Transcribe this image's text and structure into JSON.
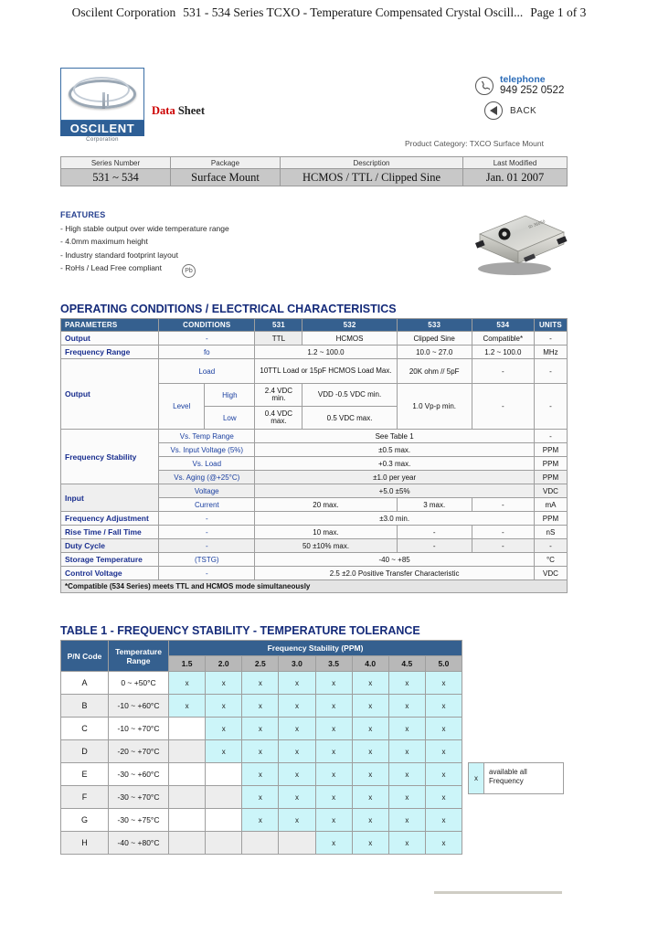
{
  "print_header": {
    "company": "Oscilent Corporation",
    "title": "531 - 534 Series TCXO - Temperature Compensated Crystal Oscill...",
    "page": "Page 1 of 3"
  },
  "logo": {
    "name": "OSCILENT",
    "sub": "Corporation",
    "data_sheet_red": "Data",
    "data_sheet_black": "Sheet"
  },
  "contact": {
    "telephone_label": "telephone",
    "telephone_number": "949 252 0522",
    "back_label": "BACK",
    "product_category": "Product Category:  TXCO Surface Mount"
  },
  "series_table": {
    "headers": [
      "Series Number",
      "Package",
      "Description",
      "Last Modified"
    ],
    "values": [
      "531 ~ 534",
      "Surface Mount",
      "HCMOS / TTL / Clipped Sine",
      "Jan. 01 2007"
    ]
  },
  "features": {
    "title": "FEATURES",
    "items": [
      "- High stable output over wide temperature range",
      "- 4.0mm maximum height",
      "- Industry standard footprint layout",
      "- RoHs / Lead Free compliant"
    ],
    "rohs_badge": "Pb"
  },
  "sections": {
    "operating": "OPERATING CONDITIONS / ELECTRICAL CHARACTERISTICS",
    "table1": "TABLE 1 -  FREQUENCY STABILITY - TEMPERATURE TOLERANCE"
  },
  "spec_table": {
    "headers": [
      "PARAMETERS",
      "CONDITIONS",
      "531",
      "532",
      "533",
      "534",
      "UNITS"
    ],
    "rows": {
      "output_param": "Output",
      "output_cond": "-",
      "output_531": "TTL",
      "output_532": "HCMOS",
      "output_533": "Clipped Sine",
      "output_534": "Compatible*",
      "output_units": "-",
      "freqrange_param": "Frequency Range",
      "freqrange_cond": "fo",
      "freqrange_531_532": "1.2 ~ 100.0",
      "freqrange_533": "10.0 ~ 27.0",
      "freqrange_534": "1.2 ~ 100.0",
      "freqrange_units": "MHz",
      "output2_param": "Output",
      "load_label": "Load",
      "load_531_532": "10TTL Load or 15pF HCMOS Load Max.",
      "load_533": "20K ohm // 5pF",
      "load_534": "-",
      "load_units": "-",
      "level_label": "Level",
      "high_label": "High",
      "high_531": "2.4 VDC min.",
      "high_532": "VDD -0.5 VDC min.",
      "level_533": "1.0 Vp-p min.",
      "level_534": "-",
      "level_units": "-",
      "low_label": "Low",
      "low_531": "0.4 VDC max.",
      "low_532": "0.5 VDC max.",
      "stability_param": "Frequency Stability",
      "vs_temp": "Vs. Temp Range",
      "vs_temp_val": "See Table 1",
      "vs_temp_units": "-",
      "vs_input": "Vs. Input Voltage (5%)",
      "vs_input_val": "±0.5 max.",
      "vs_input_units": "PPM",
      "vs_load": "Vs. Load",
      "vs_load_val": "+0.3 max.",
      "vs_load_units": "PPM",
      "vs_aging": "Vs. Aging (@+25°C)",
      "vs_aging_val": "±1.0 per year",
      "vs_aging_units": "PPM",
      "input_param": "Input",
      "voltage_label": "Voltage",
      "voltage_val": "+5.0 ±5%",
      "voltage_units": "VDC",
      "current_label": "Current",
      "current_531_532": "20 max.",
      "current_533": "3 max.",
      "current_534": "-",
      "current_units": "mA",
      "freqadj_param": "Frequency Adjustment",
      "freqadj_cond": "-",
      "freqadj_val": "±3.0 min.",
      "freqadj_units": "PPM",
      "risefall_param": "Rise Time / Fall Time",
      "risefall_cond": "-",
      "risefall_531_532": "10 max.",
      "risefall_533": "-",
      "risefall_534": "-",
      "risefall_units": "nS",
      "duty_param": "Duty Cycle",
      "duty_cond": "-",
      "duty_531_532": "50 ±10% max.",
      "duty_533": "-",
      "duty_534": "-",
      "duty_units": "-",
      "storage_param": "Storage Temperature",
      "storage_cond": "(TSTG)",
      "storage_val": "-40 ~ +85",
      "storage_units": "°C",
      "control_param": "Control Voltage",
      "control_cond": "-",
      "control_val": "2.5 ±2.0 Positive Transfer Characteristic",
      "control_units": "VDC"
    },
    "footnote": "*Compatible (534 Series) meets TTL and HCMOS mode simultaneously"
  },
  "table1": {
    "col_pn": "P/N Code",
    "col_temp": "Temperature Range",
    "col_group": "Frequency Stability (PPM)",
    "ppm_columns": [
      "1.5",
      "2.0",
      "2.5",
      "3.0",
      "3.5",
      "4.0",
      "4.5",
      "5.0"
    ],
    "mark": "x",
    "rows": [
      {
        "code": "A",
        "range": "0 ~ +50°C",
        "marks": [
          1,
          1,
          1,
          1,
          1,
          1,
          1,
          1
        ]
      },
      {
        "code": "B",
        "range": "-10 ~ +60°C",
        "marks": [
          1,
          1,
          1,
          1,
          1,
          1,
          1,
          1
        ]
      },
      {
        "code": "C",
        "range": "-10 ~ +70°C",
        "marks": [
          0,
          1,
          1,
          1,
          1,
          1,
          1,
          1
        ]
      },
      {
        "code": "D",
        "range": "-20 ~ +70°C",
        "marks": [
          0,
          1,
          1,
          1,
          1,
          1,
          1,
          1
        ]
      },
      {
        "code": "E",
        "range": "-30 ~ +60°C",
        "marks": [
          0,
          0,
          1,
          1,
          1,
          1,
          1,
          1
        ]
      },
      {
        "code": "F",
        "range": "-30 ~ +70°C",
        "marks": [
          0,
          0,
          1,
          1,
          1,
          1,
          1,
          1
        ]
      },
      {
        "code": "G",
        "range": "-30 ~ +75°C",
        "marks": [
          0,
          0,
          1,
          1,
          1,
          1,
          1,
          1
        ]
      },
      {
        "code": "H",
        "range": "-40 ~ +80°C",
        "marks": [
          0,
          0,
          0,
          0,
          1,
          1,
          1,
          1
        ]
      }
    ]
  },
  "legend": {
    "mark": "x",
    "line1": "available all",
    "line2": "Frequency"
  },
  "colors": {
    "header_blue": "#35608f",
    "title_blue": "#152b7a",
    "param_blue": "#1a2f8f",
    "mark_cyan": "#ccf5f9",
    "gray_header": "#b8b8b8"
  }
}
